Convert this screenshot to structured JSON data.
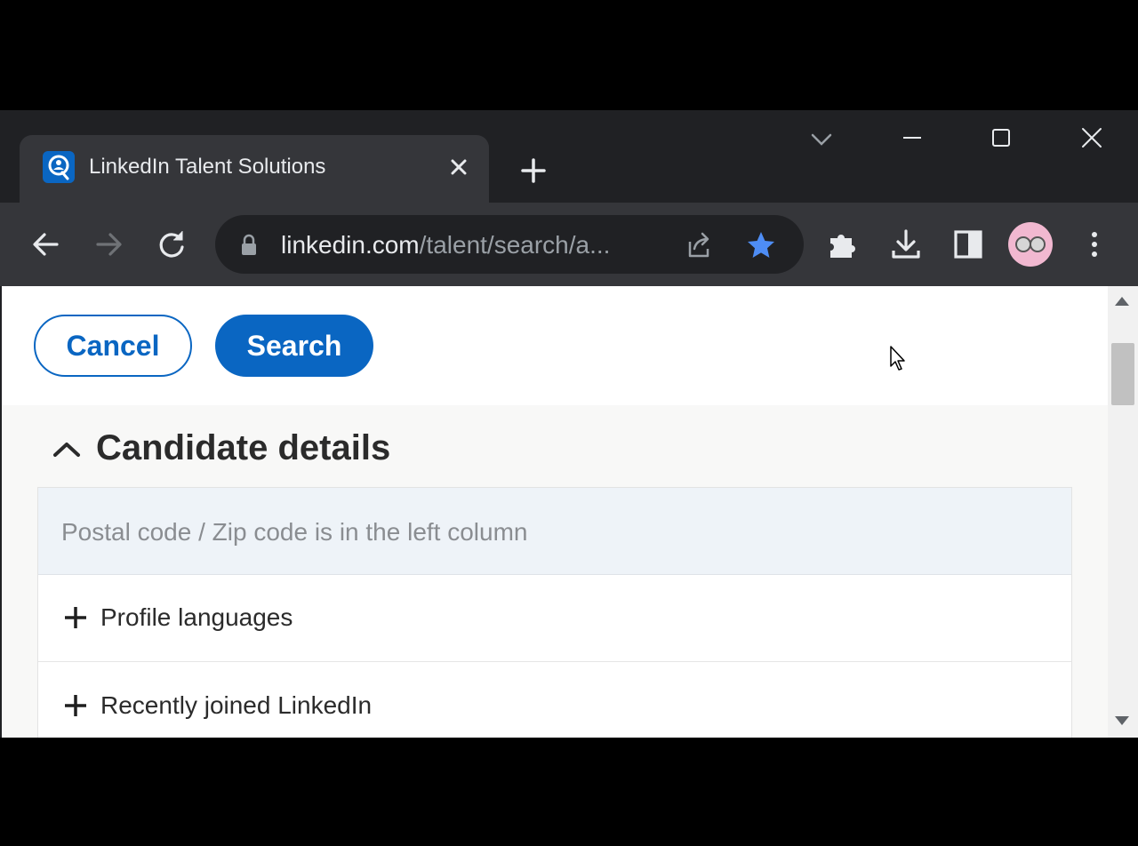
{
  "browser": {
    "tab": {
      "title": "LinkedIn Talent Solutions"
    },
    "url": {
      "host": "linkedin.com",
      "path": "/talent/search/a..."
    }
  },
  "actions": {
    "cancel_label": "Cancel",
    "search_label": "Search"
  },
  "section": {
    "title": "Candidate details",
    "notice": "Postal code / Zip code is in the left column",
    "items": [
      {
        "label": "Profile languages"
      },
      {
        "label": "Recently joined LinkedIn"
      }
    ]
  },
  "colors": {
    "accent": "#0a66c2",
    "star": "#4e8df5"
  }
}
